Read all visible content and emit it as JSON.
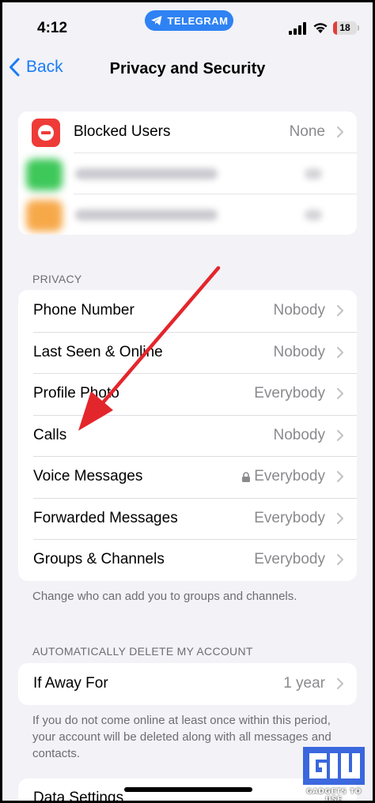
{
  "status_bar": {
    "time": "4:12",
    "app_pill": "TELEGRAM",
    "battery": "18",
    "battery_level": 0.18
  },
  "nav": {
    "back_label": "Back",
    "title": "Privacy and Security"
  },
  "blocked": {
    "label": "Blocked Users",
    "value": "None"
  },
  "privacy": {
    "header": "PRIVACY",
    "items": [
      {
        "label": "Phone Number",
        "value": "Nobody"
      },
      {
        "label": "Last Seen & Online",
        "value": "Nobody"
      },
      {
        "label": "Profile Photo",
        "value": "Everybody"
      },
      {
        "label": "Calls",
        "value": "Nobody"
      },
      {
        "label": "Voice Messages",
        "value": "Everybody"
      },
      {
        "label": "Forwarded Messages",
        "value": "Everybody"
      },
      {
        "label": "Groups & Channels",
        "value": "Everybody"
      }
    ],
    "footer": "Change who can add you to groups and channels."
  },
  "auto_delete": {
    "header": "AUTOMATICALLY DELETE MY ACCOUNT",
    "label": "If Away For",
    "value": "1 year",
    "footer": "If you do not come online at least once within this period, your account will be deleted along with all messages and contacts."
  },
  "data_settings": {
    "label": "Data Settings"
  },
  "watermark": {
    "text": "GADGETS TO USE"
  },
  "colors": {
    "accent": "#1a7cf5",
    "telegram": "#2f82f3",
    "blocked_icon": "#ee3b37",
    "annotation_arrow": "#e3262b"
  }
}
